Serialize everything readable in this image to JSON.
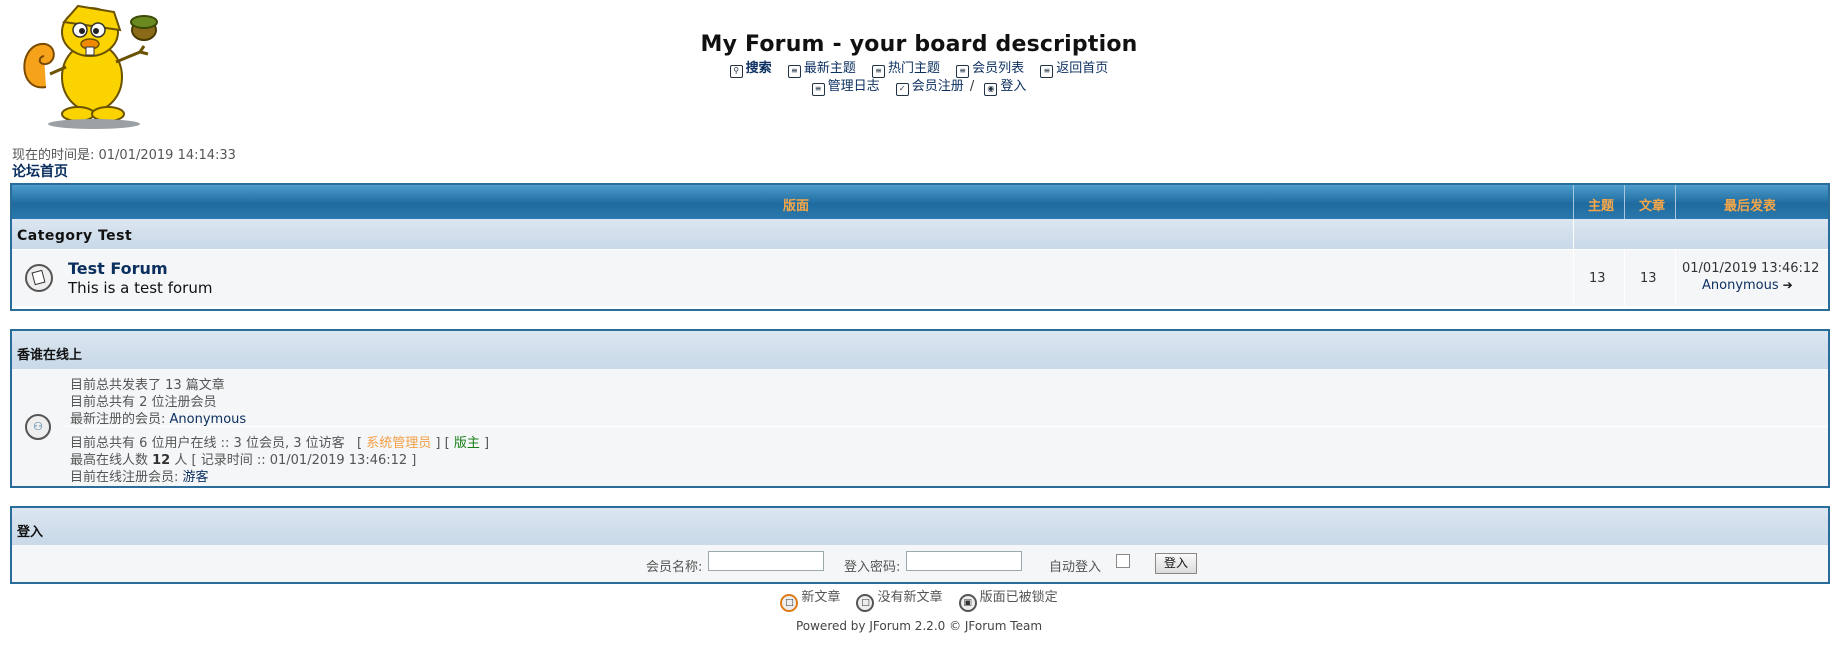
{
  "header": {
    "board_title": "My Forum - your board description",
    "nav_row1": [
      {
        "icon": "search-icon",
        "label": "搜索"
      },
      {
        "icon": "recent-topics-icon",
        "label": "最新主题"
      },
      {
        "icon": "hot-topics-icon",
        "label": "热门主题"
      },
      {
        "icon": "member-list-icon",
        "label": "会员列表"
      },
      {
        "icon": "home-icon",
        "label": "返回首页"
      }
    ],
    "nav_row2": [
      {
        "icon": "moderation-log-icon",
        "label": "管理日志"
      },
      {
        "icon": "register-icon",
        "label": "会员注册"
      },
      {
        "icon": "login-icon",
        "label": "登入"
      }
    ],
    "nav_sep": "/"
  },
  "time": {
    "text": "现在的时间是: 01/01/2019 14:14:33"
  },
  "breadcrumb": {
    "home": "论坛首页"
  },
  "forum_table": {
    "headers": {
      "forum": "版面",
      "topics": "主题",
      "posts": "文章",
      "last_post": "最后发表"
    },
    "category": "Category Test",
    "forums": [
      {
        "name": "Test Forum",
        "description": "This is a test forum",
        "topics": "13",
        "posts": "13",
        "last_post_date": "01/01/2019 13:46:12",
        "last_post_user": "Anonymous"
      }
    ]
  },
  "online": {
    "title": "香谁在线上",
    "total_posts": "目前总共发表了 13 篇文章",
    "total_users": "目前总共有 2 位注册会员",
    "newest_label": "最新注册的会员: ",
    "newest_user": "Anonymous",
    "online_now": "目前总共有 6 位用户在线 :: 3 位会员, 3 位访客",
    "bracket_open": "[",
    "admin_label": "系统管理员",
    "bracket_mid": "] [",
    "mod_label": "版主",
    "bracket_close": "]",
    "max_online_pre": "最高在线人数 ",
    "max_online_num": "12",
    "max_online_post": " 人 [ 记录时间 :: 01/01/2019 13:46:12 ]",
    "registered_online_label": "目前在线注册会员: ",
    "registered_online_value": "游客"
  },
  "login": {
    "title": "登入",
    "username_label": "会员名称:",
    "password_label": "登入密码:",
    "autologin_label": "自动登入",
    "button": "登入"
  },
  "legend": {
    "new_posts": "新文章",
    "no_new_posts": "没有新文章",
    "locked": "版面已被锁定"
  },
  "footer": {
    "text": "Powered by JForum 2.2.0 © JForum Team"
  },
  "colors": {
    "header_bar": "#1f6ba0",
    "header_text": "#f5a748",
    "link": "#0b2f5e",
    "border": "#2a6d9a",
    "admin": "#f59f45",
    "mod": "#168016"
  }
}
